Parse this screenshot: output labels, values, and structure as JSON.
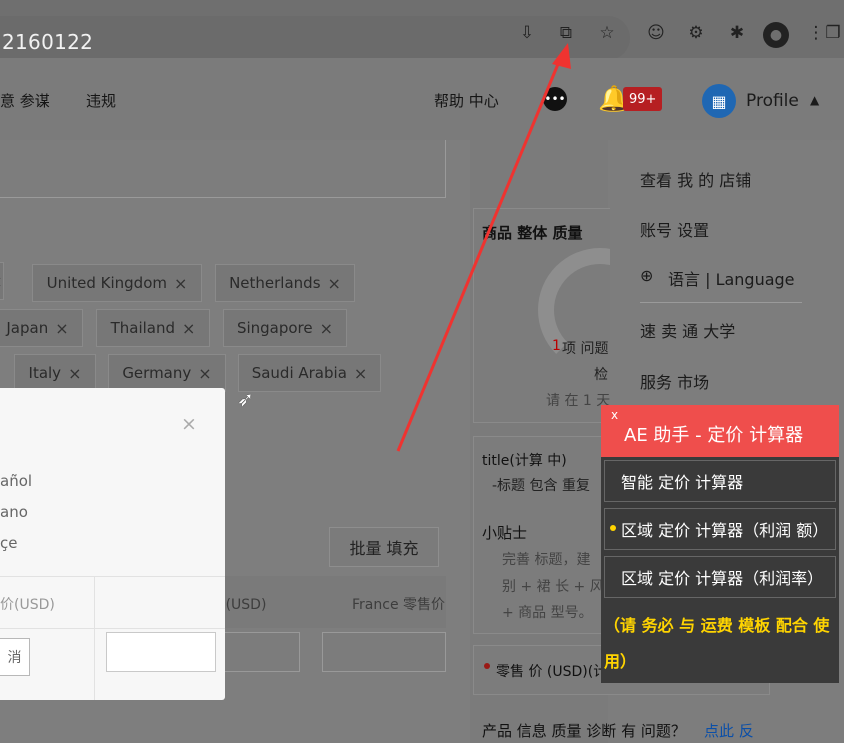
{
  "browser": {
    "address_text": "2160122"
  },
  "topnav": {
    "item_1": "意 参谋",
    "item_2": "违规",
    "help": "帮助 中心",
    "badge": "99+",
    "profile": "Profile"
  },
  "countries": [
    "United Kingdom",
    "Netherlands",
    "Japan",
    "Thailand",
    "Singapore",
    "Italy",
    "Germany",
    "Saudi Arabia"
  ],
  "modal": {
    "options": [
      "añol",
      "ano",
      "çe"
    ],
    "cancel": "消"
  },
  "table": {
    "headers": [
      "价(USD)",
      "Spain 零售价(USD)",
      "France 零售价"
    ]
  },
  "batch_fill": "批量 填充",
  "quality": {
    "title": "商品 整体 质量",
    "issue": "项 问题",
    "issue_count": "1",
    "check": "检",
    "hint": "请 在 1 天"
  },
  "menu": {
    "items": [
      "查看 我 的 店铺",
      "账号 设置",
      "语言 | Language",
      "速 卖 通 大学",
      "服务 市场"
    ]
  },
  "ae_helper": {
    "close": "x",
    "title": "AE 助手 - 定价 计算器",
    "items": [
      "智能 定价 计算器",
      "区域 定价 计算器（利润 额）",
      "区域 定价 计算器（利润率）"
    ],
    "warning": "（请 务必 与 运费 模板 配合 使 用）"
  },
  "sidecards": {
    "title_label": "title(计算 中)",
    "title_line": "-标题 包含 重复",
    "tips_label": "小贴士",
    "tips_lines": [
      "完善 标题，建",
      "别 + 裙 长 + 风格",
      "+ 商品 型号。"
    ],
    "price_label": "零售 价 (USD)(计算 中)",
    "diagnosis": "产品 信息 质量 诊断 有 问题？",
    "diagnosis_link": "点此 反"
  },
  "colors": {
    "accent": "#ef4e4c",
    "warning": "#ffd400",
    "link": "#0b4fa8"
  }
}
